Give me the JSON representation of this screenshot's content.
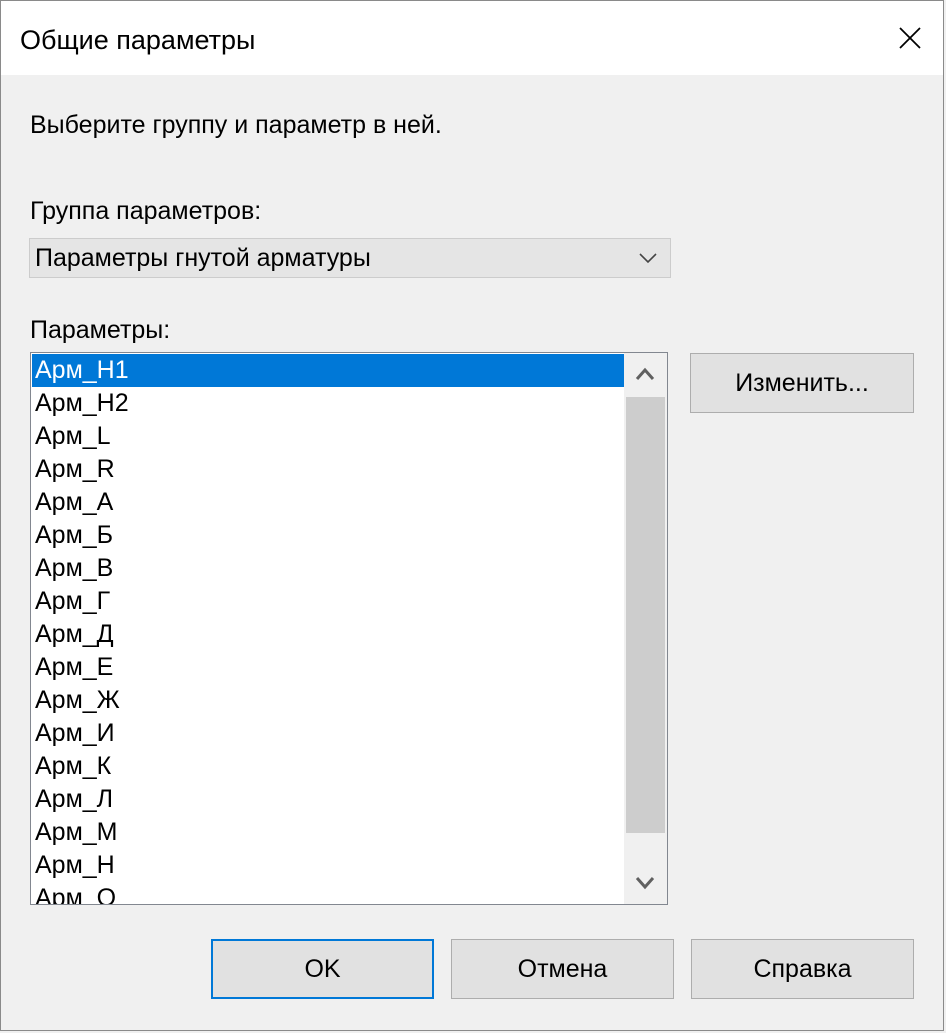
{
  "window": {
    "title": "Общие параметры",
    "close_glyph": "close-icon"
  },
  "instruction": "Выберите группу и параметр в ней.",
  "group": {
    "label": "Группа параметров:",
    "selected": "Параметры гнутой арматуры"
  },
  "parameters": {
    "label": "Параметры:",
    "selected_index": 0,
    "items": [
      "Арм_H1",
      "Арм_H2",
      "Арм_L",
      "Арм_R",
      "Арм_А",
      "Арм_Б",
      "Арм_В",
      "Арм_Г",
      "Арм_Д",
      "Арм_Е",
      "Арм_Ж",
      "Арм_И",
      "Арм_К",
      "Арм_Л",
      "Арм_М",
      "Арм_Н",
      "Арм_О"
    ]
  },
  "buttons": {
    "edit": "Изменить...",
    "ok": "OK",
    "cancel": "Отмена",
    "help": "Справка"
  },
  "colors": {
    "selection": "#0078d7",
    "dialog_bg": "#f0f0f0",
    "titlebar_bg": "#ffffff"
  }
}
